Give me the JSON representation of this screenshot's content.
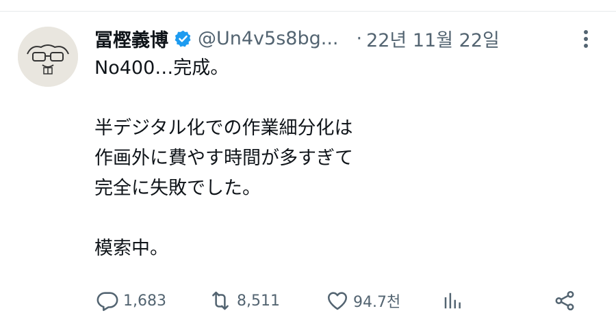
{
  "tweet": {
    "author": {
      "display_name": "冨樫義博",
      "handle": "@Un4v5s8bg...",
      "verified": true
    },
    "separator": "·",
    "timestamp": "22년 11월 22일",
    "body_lines": [
      "No400…完成。",
      "",
      "半デジタル化での作業細分化は",
      "作画外に費やす時間が多すぎて",
      "完全に失敗でした。",
      "",
      "模索中。"
    ],
    "stats": {
      "replies": "1,683",
      "retweets": "8,511",
      "likes": "94.7천"
    }
  },
  "colors": {
    "text_primary": "#0f1419",
    "text_secondary": "#536471",
    "verified_blue": "#1d9bf0"
  },
  "icons": [
    "avatar",
    "verified-icon",
    "more-icon",
    "reply-icon",
    "retweet-icon",
    "like-icon",
    "views-icon",
    "share-icon"
  ]
}
